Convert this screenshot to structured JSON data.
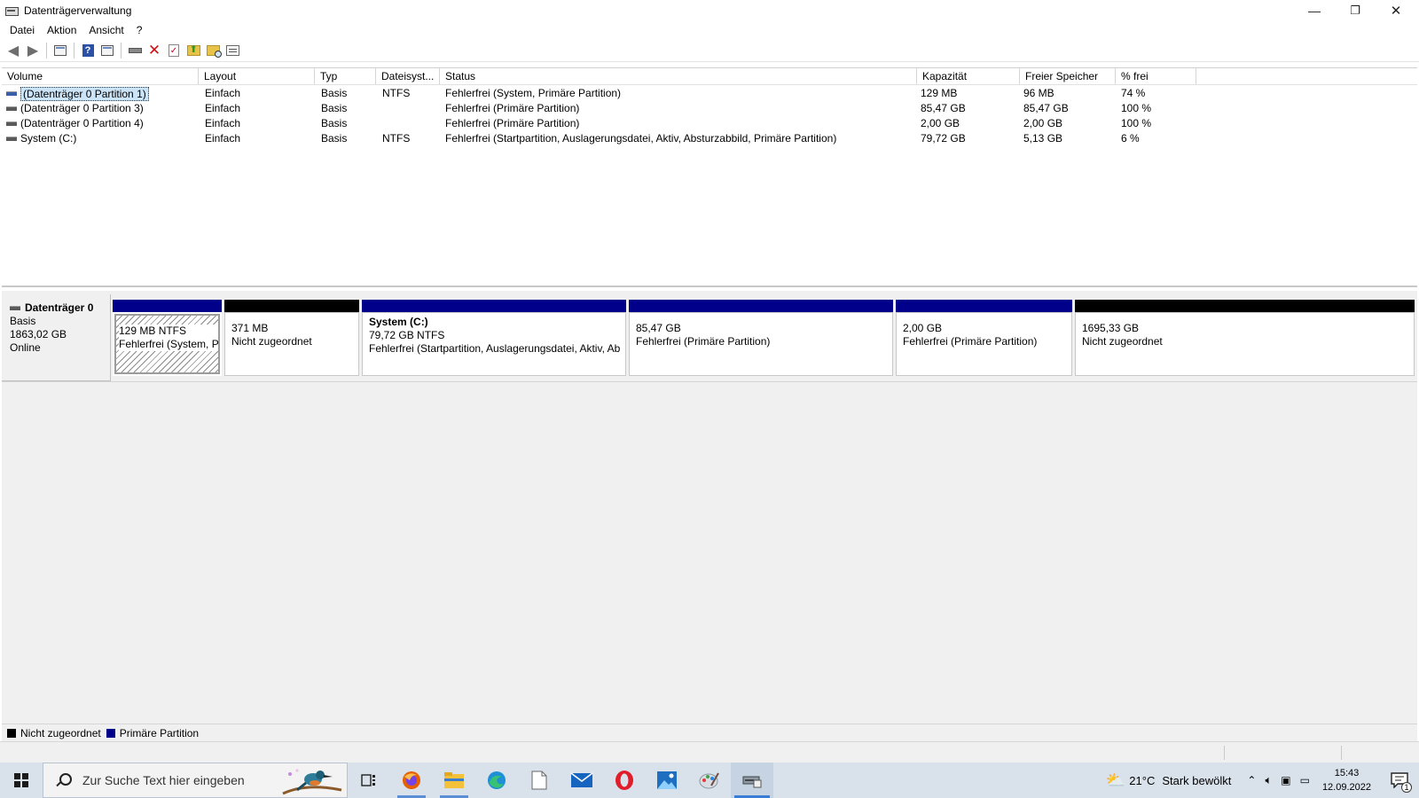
{
  "window": {
    "title": "Datenträgerverwaltung",
    "minimize": "—",
    "restore": "❐",
    "close": "✕"
  },
  "menu": [
    "Datei",
    "Aktion",
    "Ansicht",
    "?"
  ],
  "toolbar_icons": [
    "back-arrow-icon",
    "forward-arrow-icon",
    "console-tree-icon",
    "help-icon",
    "properties-icon",
    "connect-drive-icon",
    "delete-icon",
    "check-icon",
    "folder-up-icon",
    "folder-search-icon",
    "list-icon"
  ],
  "volumes": {
    "columns": [
      "Volume",
      "Layout",
      "Typ",
      "Dateisyst...",
      "Status",
      "Kapazität",
      "Freier Speicher",
      "% frei"
    ],
    "rows": [
      {
        "volume": "(Datenträger 0 Partition 1)",
        "layout": "Einfach",
        "typ": "Basis",
        "fs": "NTFS",
        "status": "Fehlerfrei (System, Primäre Partition)",
        "kap": "129 MB",
        "frei": "96 MB",
        "pct": "74 %"
      },
      {
        "volume": "(Datenträger 0 Partition 3)",
        "layout": "Einfach",
        "typ": "Basis",
        "fs": "",
        "status": "Fehlerfrei (Primäre Partition)",
        "kap": "85,47 GB",
        "frei": "85,47 GB",
        "pct": "100 %"
      },
      {
        "volume": "(Datenträger 0 Partition 4)",
        "layout": "Einfach",
        "typ": "Basis",
        "fs": "",
        "status": "Fehlerfrei (Primäre Partition)",
        "kap": "2,00 GB",
        "frei": "2,00 GB",
        "pct": "100 %"
      },
      {
        "volume": "System (C:)",
        "layout": "Einfach",
        "typ": "Basis",
        "fs": "NTFS",
        "status": "Fehlerfrei (Startpartition, Auslagerungsdatei, Aktiv, Absturzabbild, Primäre Partition)",
        "kap": "79,72 GB",
        "frei": "5,13 GB",
        "pct": "6 %"
      }
    ]
  },
  "disk": {
    "name": "Datenträger 0",
    "type": "Basis",
    "size": "1863,02 GB",
    "state": "Online",
    "partitions": [
      {
        "name": "",
        "line1": "129 MB NTFS",
        "line2": "Fehlerfrei (System, Pr",
        "kind": "primary"
      },
      {
        "name": "",
        "line1": "371 MB",
        "line2": "Nicht zugeordnet",
        "kind": "unallocated"
      },
      {
        "name": "System  (C:)",
        "line1": "79,72 GB NTFS",
        "line2": "Fehlerfrei (Startpartition, Auslagerungsdatei, Aktiv, Ab",
        "kind": "primary"
      },
      {
        "name": "",
        "line1": "85,47 GB",
        "line2": "Fehlerfrei (Primäre Partition)",
        "kind": "primary"
      },
      {
        "name": "",
        "line1": "2,00 GB",
        "line2": "Fehlerfrei (Primäre Partition)",
        "kind": "primary"
      },
      {
        "name": "",
        "line1": "1695,33 GB",
        "line2": "Nicht zugeordnet",
        "kind": "unallocated"
      }
    ]
  },
  "legend": {
    "unallocated": "Nicht zugeordnet",
    "primary": "Primäre Partition"
  },
  "colors": {
    "primary": "#00008b",
    "unallocated": "#000000",
    "selection": "#cce4f7"
  },
  "taskbar": {
    "search_placeholder": "Zur Suche Text hier eingeben",
    "weather_temp": "21°C",
    "weather_text": "Stark bewölkt",
    "time": "15:43",
    "date": "12.09.2022",
    "notification_count": "1",
    "apps": [
      "task-view-icon",
      "firefox-icon",
      "file-explorer-icon",
      "edge-icon",
      "notepad-icon",
      "mail-icon",
      "opera-icon",
      "photos-icon",
      "paint-icon",
      "disk-management-icon"
    ]
  }
}
